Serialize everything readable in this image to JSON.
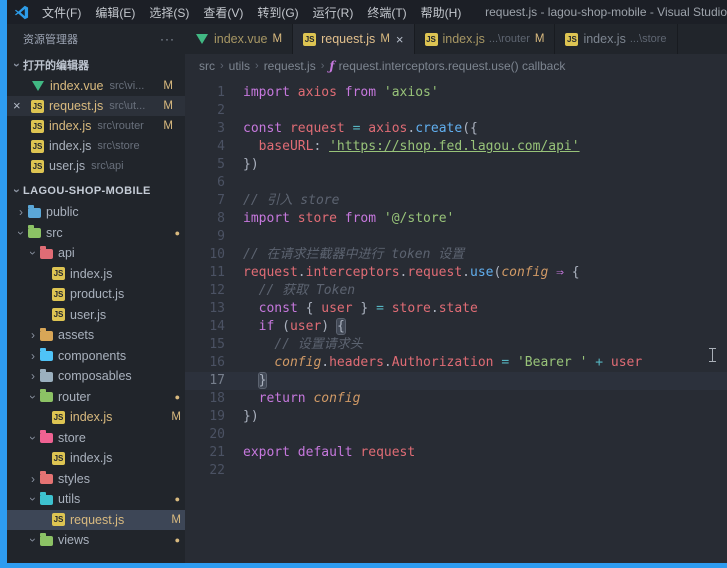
{
  "colors": {
    "accent": "#2e9cf0",
    "modified_gold": "#d9ba7f",
    "selection": "#3d4656",
    "js_icon": "#ddc452",
    "vue_icon": "#41b883"
  },
  "titlebar": {
    "title": "request.js - lagou-shop-mobile - Visual Studio",
    "menus": [
      {
        "key": "file",
        "label": "文件(F)"
      },
      {
        "key": "edit",
        "label": "编辑(E)"
      },
      {
        "key": "selection",
        "label": "选择(S)"
      },
      {
        "key": "view",
        "label": "查看(V)"
      },
      {
        "key": "goto",
        "label": "转到(G)"
      },
      {
        "key": "run",
        "label": "运行(R)"
      },
      {
        "key": "terminal",
        "label": "终端(T)"
      },
      {
        "key": "help",
        "label": "帮助(H)"
      }
    ]
  },
  "sidebar": {
    "header": "资源管理器",
    "more_label": "···",
    "open_editors": {
      "label": "打开的编辑器",
      "items": [
        {
          "icon": "vue",
          "name": "index.vue",
          "path": "src\\vi...",
          "badge": "M"
        },
        {
          "icon": "js",
          "name": "request.js",
          "path": "src\\ut...",
          "badge": "M",
          "active": true,
          "close": "×"
        },
        {
          "icon": "js",
          "name": "index.js",
          "path": "src\\router",
          "badge": "M"
        },
        {
          "icon": "js",
          "name": "index.js",
          "path": "src\\store"
        },
        {
          "icon": "js",
          "name": "user.js",
          "path": "src\\api"
        }
      ]
    },
    "tree": {
      "root": "LAGOU-SHOP-MOBILE",
      "items": [
        {
          "kind": "folder",
          "name": "public",
          "depth": 0,
          "expanded": false,
          "color": "#5ba7d7"
        },
        {
          "kind": "folder",
          "name": "src",
          "depth": 0,
          "expanded": true,
          "color": "#8cc265",
          "dot": "●"
        },
        {
          "kind": "folder",
          "name": "api",
          "depth": 1,
          "expanded": true,
          "color": "#e06c75"
        },
        {
          "kind": "file",
          "name": "index.js",
          "depth": 2,
          "icon": "js"
        },
        {
          "kind": "file",
          "name": "product.js",
          "depth": 2,
          "icon": "js"
        },
        {
          "kind": "file",
          "name": "user.js",
          "depth": 2,
          "icon": "js"
        },
        {
          "kind": "folder",
          "name": "assets",
          "depth": 1,
          "expanded": false,
          "color": "#d8a657"
        },
        {
          "kind": "folder",
          "name": "components",
          "depth": 1,
          "expanded": false,
          "color": "#4fc3f7"
        },
        {
          "kind": "folder",
          "name": "composables",
          "depth": 1,
          "expanded": false,
          "color": "#9bb0bf"
        },
        {
          "kind": "folder",
          "name": "router",
          "depth": 1,
          "expanded": true,
          "color": "#8cc265",
          "dot": "●"
        },
        {
          "kind": "file",
          "name": "index.js",
          "depth": 2,
          "icon": "js",
          "badge": "M",
          "modified": true
        },
        {
          "kind": "folder",
          "name": "store",
          "depth": 1,
          "expanded": true,
          "color": "#ef6292"
        },
        {
          "kind": "file",
          "name": "index.js",
          "depth": 2,
          "icon": "js"
        },
        {
          "kind": "folder",
          "name": "styles",
          "depth": 1,
          "expanded": false,
          "color": "#e57373"
        },
        {
          "kind": "folder",
          "name": "utils",
          "depth": 1,
          "expanded": true,
          "color": "#3dc2cf",
          "dot": "●"
        },
        {
          "kind": "file",
          "name": "request.js",
          "depth": 2,
          "icon": "js",
          "badge": "M",
          "modified": true,
          "selected": true
        },
        {
          "kind": "folder",
          "name": "views",
          "depth": 1,
          "expanded": true,
          "color": "#8cc265",
          "dot": "●"
        }
      ]
    }
  },
  "tabs": [
    {
      "icon": "vue",
      "name": "index.vue",
      "badge": "M",
      "modified": true
    },
    {
      "icon": "js",
      "name": "request.js",
      "badge": "M",
      "modified": true,
      "active": true,
      "close": "×"
    },
    {
      "icon": "js",
      "name": "index.js",
      "desc": "...\\router",
      "badge": "M",
      "modified": true
    },
    {
      "icon": "js",
      "name": "index.js",
      "desc": "...\\store"
    }
  ],
  "breadcrumbs": {
    "items": [
      "src",
      "utils",
      "request.js"
    ],
    "symbol": "request.interceptors.request.use() callback"
  },
  "editor": {
    "active_line": 17,
    "lines": [
      [
        [
          "k",
          "import"
        ],
        [
          "t",
          " "
        ],
        [
          "v",
          "axios"
        ],
        [
          "t",
          " "
        ],
        [
          "k",
          "from"
        ],
        [
          "t",
          " "
        ],
        [
          "s",
          "'axios'"
        ]
      ],
      [],
      [
        [
          "k",
          "const"
        ],
        [
          "t",
          " "
        ],
        [
          "v",
          "request"
        ],
        [
          "t",
          " "
        ],
        [
          "o",
          "="
        ],
        [
          "t",
          " "
        ],
        [
          "v",
          "axios"
        ],
        [
          "p",
          "."
        ],
        [
          "f",
          "create"
        ],
        [
          "p",
          "({"
        ]
      ],
      [
        [
          "t",
          "  "
        ],
        [
          "v",
          "baseURL"
        ],
        [
          "p",
          ":"
        ],
        [
          "t",
          " "
        ],
        [
          "su",
          "'https://shop.fed.lagou.com/api'"
        ]
      ],
      [
        [
          "p",
          "})"
        ]
      ],
      [],
      [
        [
          "c",
          "// 引入 store"
        ]
      ],
      [
        [
          "k",
          "import"
        ],
        [
          "t",
          " "
        ],
        [
          "v",
          "store"
        ],
        [
          "t",
          " "
        ],
        [
          "k",
          "from"
        ],
        [
          "t",
          " "
        ],
        [
          "s",
          "'@/store'"
        ]
      ],
      [],
      [
        [
          "c",
          "// 在请求拦截器中进行 token 设置"
        ]
      ],
      [
        [
          "v",
          "request"
        ],
        [
          "p",
          "."
        ],
        [
          "v",
          "interceptors"
        ],
        [
          "p",
          "."
        ],
        [
          "v",
          "request"
        ],
        [
          "p",
          "."
        ],
        [
          "f",
          "use"
        ],
        [
          "p",
          "("
        ],
        [
          "a",
          "config"
        ],
        [
          "t",
          " "
        ],
        [
          "k",
          "⇒"
        ],
        [
          "t",
          " "
        ],
        [
          "p",
          "{"
        ]
      ],
      [
        [
          "t",
          "  "
        ],
        [
          "c",
          "// 获取 Token"
        ]
      ],
      [
        [
          "t",
          "  "
        ],
        [
          "k",
          "const"
        ],
        [
          "t",
          " "
        ],
        [
          "p",
          "{"
        ],
        [
          "t",
          " "
        ],
        [
          "v",
          "user"
        ],
        [
          "t",
          " "
        ],
        [
          "p",
          "}"
        ],
        [
          "t",
          " "
        ],
        [
          "o",
          "="
        ],
        [
          "t",
          " "
        ],
        [
          "v",
          "store"
        ],
        [
          "p",
          "."
        ],
        [
          "v",
          "state"
        ]
      ],
      [
        [
          "t",
          "  "
        ],
        [
          "k",
          "if"
        ],
        [
          "t",
          " "
        ],
        [
          "p",
          "("
        ],
        [
          "v",
          "user"
        ],
        [
          "p",
          ")"
        ],
        [
          "t",
          " "
        ],
        [
          "pm",
          "{"
        ]
      ],
      [
        [
          "t",
          "    "
        ],
        [
          "c",
          "// 设置请求头"
        ]
      ],
      [
        [
          "t",
          "    "
        ],
        [
          "a",
          "config"
        ],
        [
          "p",
          "."
        ],
        [
          "v",
          "headers"
        ],
        [
          "p",
          "."
        ],
        [
          "v",
          "Authorization"
        ],
        [
          "t",
          " "
        ],
        [
          "o",
          "="
        ],
        [
          "t",
          " "
        ],
        [
          "s",
          "'Bearer '"
        ],
        [
          "t",
          " "
        ],
        [
          "o",
          "+"
        ],
        [
          "t",
          " "
        ],
        [
          "v",
          "user"
        ]
      ],
      [
        [
          "t",
          "  "
        ],
        [
          "pm",
          "}"
        ]
      ],
      [
        [
          "t",
          "  "
        ],
        [
          "k",
          "return"
        ],
        [
          "t",
          " "
        ],
        [
          "a",
          "config"
        ]
      ],
      [
        [
          "p",
          "})"
        ]
      ],
      [],
      [
        [
          "k",
          "export"
        ],
        [
          "t",
          " "
        ],
        [
          "k",
          "default"
        ],
        [
          "t",
          " "
        ],
        [
          "v",
          "request"
        ]
      ],
      []
    ]
  }
}
